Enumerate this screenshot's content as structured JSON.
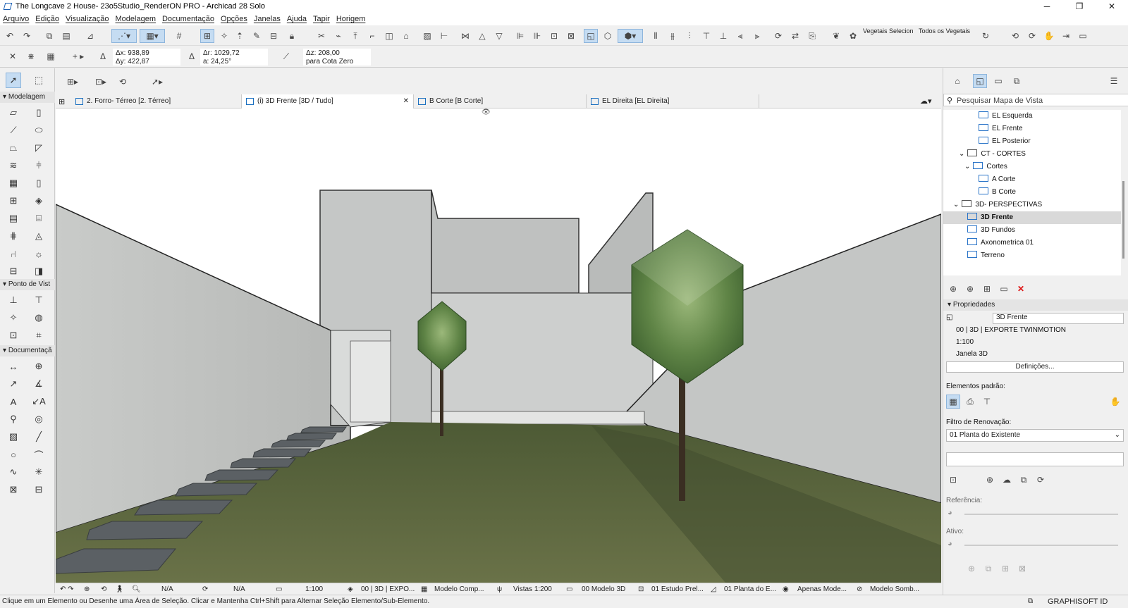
{
  "window": {
    "title": "The Longcave 2 House- 23o5Studio_RenderON PRO - Archicad 28 Solo",
    "min": "─",
    "max": "❐",
    "close": "✕"
  },
  "menu": [
    "Arquivo",
    "Edição",
    "Visualização",
    "Modelagem",
    "Documentação",
    "Opções",
    "Janelas",
    "Ajuda",
    "Tapir",
    "Horigem"
  ],
  "toolbar": {
    "vegetais_label": "Vegetais Selecion",
    "todos_vegetais_label": "Todos os Vegetais"
  },
  "coords": {
    "dx": "Δx: 938,89",
    "dy": "Δy: 422,87",
    "dr": "Δr: 1029,72",
    "da": "a: 24,25°",
    "dz": "Δz: 208,00",
    "ref": "para Cota Zero"
  },
  "palette": {
    "modelagem": "Modelagem",
    "ponto_de_vista": "Ponto de Vist",
    "documentacao": "Documentaçã"
  },
  "tabs": [
    {
      "label": "2. Forro- Térreo [2. Térreo]"
    },
    {
      "label": "(i) 3D Frente [3D / Tudo]",
      "close": "✕"
    },
    {
      "label": "B Corte [B Corte]"
    },
    {
      "label": "EL Direita [EL Direita]"
    }
  ],
  "viewstatus": {
    "na1": "N/A",
    "na2": "N/A",
    "scale": "1:100",
    "layer": "00 | 3D | EXPO...",
    "model": "Modelo Comp...",
    "vistas": "Vistas 1:200",
    "modelo3d": "00 Modelo 3D",
    "estudo": "01 Estudo Prel...",
    "planta": "01 Planta do E...",
    "apenas": "Apenas Mode...",
    "sombra": "Modelo Somb..."
  },
  "message": "Clique em um Elemento ou Desenhe uma Área de Seleção. Clicar e Mantenha Ctrl+Shift para Alternar Seleção Elemento/Sub-Elemento.",
  "brand": "GRAPHISOFT ID",
  "navigator": {
    "search_placeholder": "Pesquisar Mapa de Vista",
    "items": [
      {
        "label": "EL Esquerda"
      },
      {
        "label": "EL Frente"
      },
      {
        "label": "EL Posterior"
      },
      {
        "label": "CT - CORTES"
      },
      {
        "label": "Cortes"
      },
      {
        "label": "A Corte"
      },
      {
        "label": "B Corte"
      },
      {
        "label": "3D- PERSPECTIVAS"
      },
      {
        "label": "3D Frente"
      },
      {
        "label": "3D Fundos"
      },
      {
        "label": "Axonometrica 01"
      },
      {
        "label": "Terreno"
      }
    ]
  },
  "properties": {
    "header": "Propriedades",
    "name": "3D Frente",
    "layer": "00 | 3D | EXPORTE TWINMOTION",
    "scale": "1:100",
    "window": "Janela 3D",
    "definitions_button": "Definições...",
    "elementos_padrao": "Elementos padrão:",
    "filtro_label": "Filtro de Renovação:",
    "filtro_value": "01 Planta do Existente",
    "referencia": "Referência:",
    "ativo": "Ativo:"
  }
}
